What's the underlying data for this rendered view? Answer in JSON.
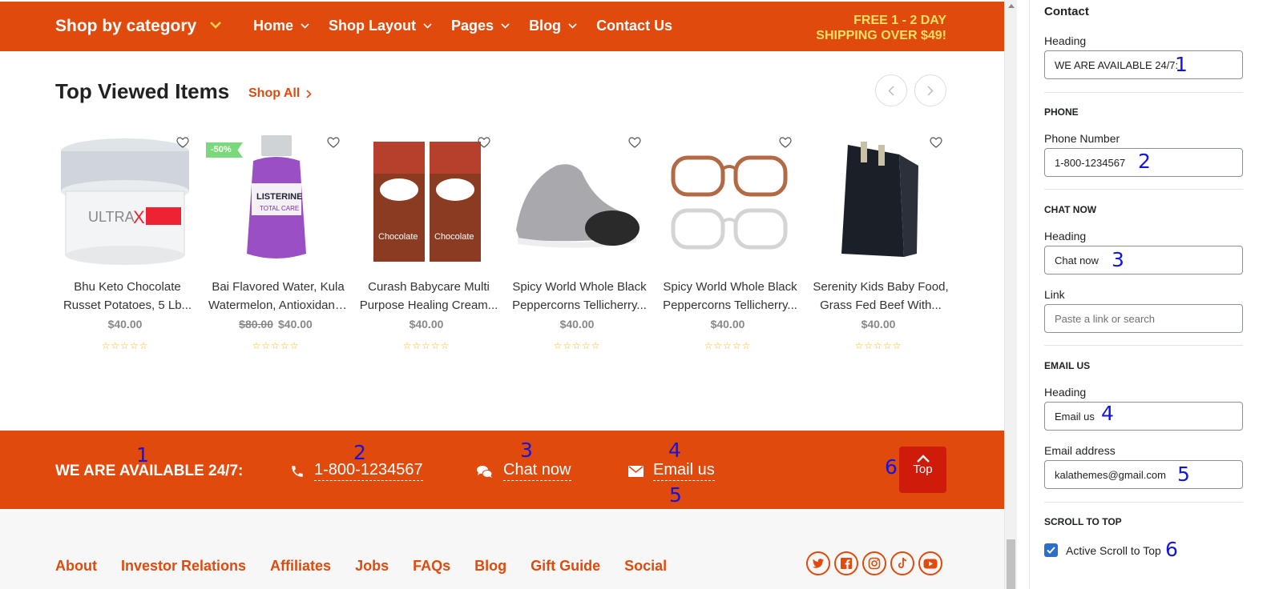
{
  "header": {
    "shop_by_category": "Shop by category",
    "nav": [
      "Home",
      "Shop Layout",
      "Pages",
      "Blog",
      "Contact Us"
    ],
    "promo_line1": "FREE 1 - 2 DAY",
    "promo_line2": "SHIPPING OVER $49!"
  },
  "section": {
    "title": "Top Viewed Items",
    "shop_all": "Shop All"
  },
  "products": [
    {
      "name1": "Bhu Keto Chocolate",
      "name2": "Russet Potatoes, 5 Lb...",
      "old_price": "",
      "price": "$40.00",
      "stars": "☆☆☆☆☆",
      "image": "cream-jar-image"
    },
    {
      "name1": "Bai Flavored Water, Kula",
      "name2": "Watermelon, Antioxidant...",
      "old_price": "$80.00",
      "price": "$40.00",
      "stars": "☆☆☆☆☆",
      "image": "mouthwash-bottle-image",
      "badge": "-50%"
    },
    {
      "name1": "Curash Babycare Multi",
      "name2": "Purpose Healing Cream...",
      "old_price": "",
      "price": "$40.00",
      "stars": "☆☆☆☆☆",
      "image": "milk-cartons-image"
    },
    {
      "name1": "Spicy World Whole Black",
      "name2": "Peppercorns Tellicherry...",
      "old_price": "",
      "price": "$40.00",
      "stars": "☆☆☆☆☆",
      "image": "sneakers-image"
    },
    {
      "name1": "Spicy World Whole Black",
      "name2": "Peppercorns Tellicherry...",
      "old_price": "",
      "price": "$40.00",
      "stars": "☆☆☆☆☆",
      "image": "eyeglasses-image"
    },
    {
      "name1": "Serenity Kids Baby Food,",
      "name2": "Grass Fed Beef With...",
      "old_price": "",
      "price": "$40.00",
      "stars": "☆☆☆☆☆",
      "image": "wallet-image"
    }
  ],
  "contact_bar": {
    "heading": "WE ARE AVAILABLE 24/7:",
    "phone": "1-800-1234567",
    "chat": "Chat now",
    "email": "Email us",
    "top_label": "Top"
  },
  "footer": {
    "links": [
      "About",
      "Investor Relations",
      "Affiliates",
      "Jobs",
      "FAQs",
      "Blog",
      "Gift Guide",
      "Social"
    ],
    "social_icons": [
      "twitter-icon",
      "facebook-icon",
      "instagram-icon",
      "tiktok-icon",
      "youtube-icon"
    ]
  },
  "panel": {
    "title": "Contact",
    "heading_label": "Heading",
    "heading_value": "WE ARE AVAILABLE 24/7:",
    "phone_section": "PHONE",
    "phone_label": "Phone Number",
    "phone_value": "1-800-1234567",
    "chat_section": "CHAT NOW",
    "chat_heading_label": "Heading",
    "chat_heading_value": "Chat now",
    "link_label": "Link",
    "link_placeholder": "Paste a link or search",
    "email_section": "EMAIL US",
    "email_heading_label": "Heading",
    "email_heading_value": "Email us",
    "email_address_label": "Email address",
    "email_address_value": "kalathemes@gmail.com",
    "scroll_section": "SCROLL TO TOP",
    "scroll_checkbox_label": "Active Scroll to Top",
    "scroll_checked": true
  },
  "annotations": [
    "1",
    "2",
    "3",
    "4",
    "5",
    "6"
  ],
  "colors": {
    "brand": "#e04a0c",
    "promo": "#ffe066",
    "top_button": "#cf1b0a",
    "annotation": "#1414e0",
    "checkbox": "#2c6ecb"
  }
}
